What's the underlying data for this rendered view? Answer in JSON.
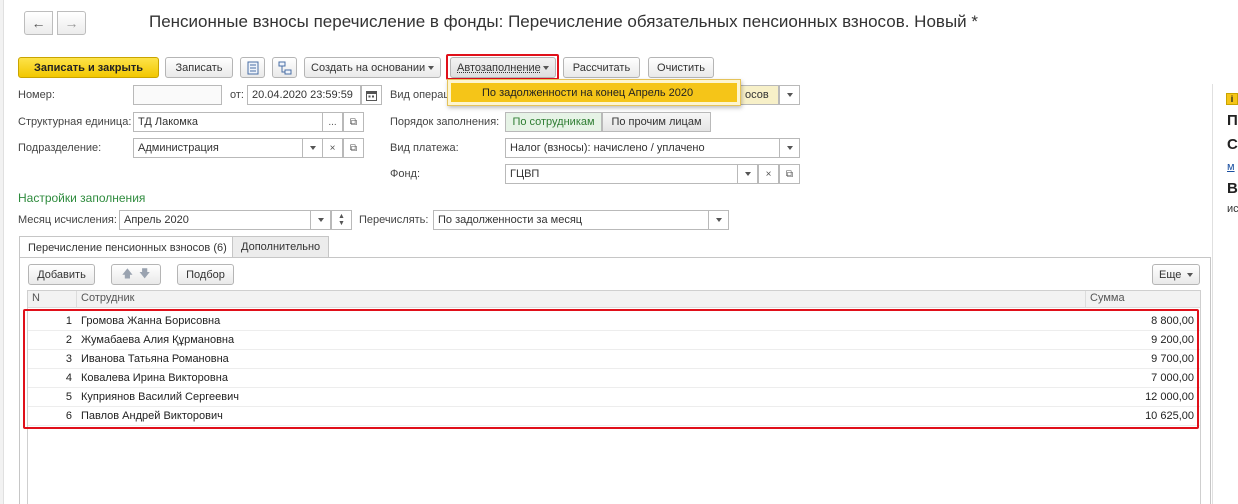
{
  "window": {
    "title": "Пенсионные взносы перечисление в фонды: Перечисление обязательных пенсионных взносов. Новый *",
    "nav_back_icon": "arrow-left-icon",
    "nav_forward_icon": "arrow-right-icon"
  },
  "toolbar": {
    "save_close_label": "Записать и закрыть",
    "save_label": "Записать",
    "create_based_label": "Создать на основании",
    "autofill_label": "Автозаполнение",
    "calculate_label": "Рассчитать",
    "clear_label": "Очистить",
    "autofill_menu_item": "По задолженности на конец Апрель 2020"
  },
  "form": {
    "number_label": "Номер:",
    "number_value": "",
    "date_label": "от:",
    "date_value": "20.04.2020 23:59:59",
    "operation_label": "Вид операц",
    "operation_value_tail": "осов",
    "unit_label": "Структурная единица:",
    "unit_value": "ТД Лакомка",
    "fill_order_label": "Порядок заполнения:",
    "fill_order_options": [
      "По сотрудникам",
      "По прочим лицам"
    ],
    "department_label": "Подразделение:",
    "department_value": "Администрация",
    "payment_type_label": "Вид платежа:",
    "payment_type_value": "Налог (взносы): начислено / уплачено",
    "fund_label": "Фонд:",
    "fund_value": "ГЦВП"
  },
  "fill_settings": {
    "heading": "Настройки заполнения",
    "month_label": "Месяц исчисления:",
    "month_value": "Апрель 2020",
    "transfer_label": "Перечислять:",
    "transfer_value": "По задолженности за месяц"
  },
  "tabs": [
    {
      "label": "Перечисление пенсионных взносов (6)"
    },
    {
      "label": "Дополнительно"
    }
  ],
  "table_toolbar": {
    "add_label": "Добавить",
    "pick_label": "Подбор",
    "more_label": "Еще"
  },
  "table": {
    "columns": [
      "N",
      "Сотрудник",
      "Сумма"
    ],
    "rows": [
      {
        "n": "1",
        "employee": "Громова Жанна Борисовна",
        "amount": "8 800,00"
      },
      {
        "n": "2",
        "employee": "Жумабаева Алия Құрмановна",
        "amount": "9 200,00"
      },
      {
        "n": "3",
        "employee": "Иванова Татьяна Романовна",
        "amount": "9 700,00"
      },
      {
        "n": "4",
        "employee": "Ковалева Ирина Викторовна",
        "amount": "7 000,00"
      },
      {
        "n": "5",
        "employee": "Куприянов Василий Сергеевич",
        "amount": "12 000,00"
      },
      {
        "n": "6",
        "employee": "Павлов Андрей Викторович",
        "amount": "10 625,00"
      }
    ]
  },
  "right_panel": {
    "line1": "П",
    "line2": "С",
    "line3": "м",
    "line4": "В",
    "line5": "ис"
  },
  "colors": {
    "accent_yellow": "#f5c518",
    "highlight_red": "#e0101a",
    "section_green": "#2e8b3d"
  }
}
